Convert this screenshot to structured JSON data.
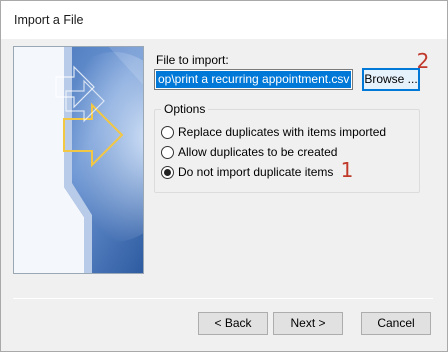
{
  "dialog": {
    "title": "Import a File"
  },
  "file_to_import": {
    "label": "File to import:",
    "value": "op\\print a recurring appointment.csv",
    "browse_label": "Browse ..."
  },
  "options": {
    "legend": "Options",
    "items": [
      {
        "label": "Replace duplicates with items imported",
        "checked": false
      },
      {
        "label": "Allow duplicates to be created",
        "checked": false
      },
      {
        "label": "Do not import duplicate items",
        "checked": true
      }
    ]
  },
  "annotations": {
    "step1": "1",
    "step2": "2"
  },
  "footer": {
    "back_label": "< Back",
    "next_label": "Next >",
    "cancel_label": "Cancel"
  },
  "colors": {
    "selection": "#0078d7",
    "badge": "#c0392b",
    "graphic_blue": "#4a74b8"
  }
}
